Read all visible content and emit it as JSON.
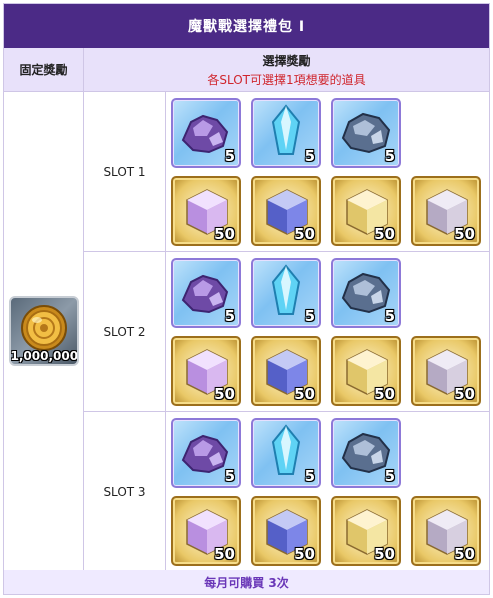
{
  "title": "魔獸戰選擇禮包 Ⅰ",
  "header": {
    "fixed_reward": "固定獎勵",
    "choose_reward": "選擇獎勵",
    "choose_note": "各SLOT可選擇1項想要的道具"
  },
  "fixed_item": {
    "icon": "gold-coin-icon",
    "quantity": "1,000,000"
  },
  "slots": [
    {
      "label": "SLOT 1",
      "row1": [
        {
          "icon": "purple-ore-icon",
          "qty": "5"
        },
        {
          "icon": "blue-crystal-icon",
          "qty": "5"
        },
        {
          "icon": "dark-ore-icon",
          "qty": "5"
        }
      ],
      "row2": [
        {
          "icon": "purple-cube-icon",
          "qty": "50"
        },
        {
          "icon": "blue-cube-icon",
          "qty": "50"
        },
        {
          "icon": "gold-cube-icon",
          "qty": "50"
        },
        {
          "icon": "gray-cube-icon",
          "qty": "50"
        }
      ]
    },
    {
      "label": "SLOT 2",
      "row1": [
        {
          "icon": "purple-ore-icon",
          "qty": "5"
        },
        {
          "icon": "blue-crystal-icon",
          "qty": "5"
        },
        {
          "icon": "dark-ore-icon",
          "qty": "5"
        }
      ],
      "row2": [
        {
          "icon": "purple-cube-icon",
          "qty": "50"
        },
        {
          "icon": "blue-cube-icon",
          "qty": "50"
        },
        {
          "icon": "gold-cube-icon",
          "qty": "50"
        },
        {
          "icon": "gray-cube-icon",
          "qty": "50"
        }
      ]
    },
    {
      "label": "SLOT 3",
      "row1": [
        {
          "icon": "purple-ore-icon",
          "qty": "5"
        },
        {
          "icon": "blue-crystal-icon",
          "qty": "5"
        },
        {
          "icon": "dark-ore-icon",
          "qty": "5"
        }
      ],
      "row2": [
        {
          "icon": "purple-cube-icon",
          "qty": "50"
        },
        {
          "icon": "blue-cube-icon",
          "qty": "50"
        },
        {
          "icon": "gold-cube-icon",
          "qty": "50"
        },
        {
          "icon": "gray-cube-icon",
          "qty": "50"
        }
      ]
    }
  ],
  "footer": "每月可購買 3次",
  "colors": {
    "title_bg": "#4b2a86",
    "header_bg": "#e8e1fa",
    "note_red": "#d0262d",
    "footer_text": "#6a37b8"
  }
}
